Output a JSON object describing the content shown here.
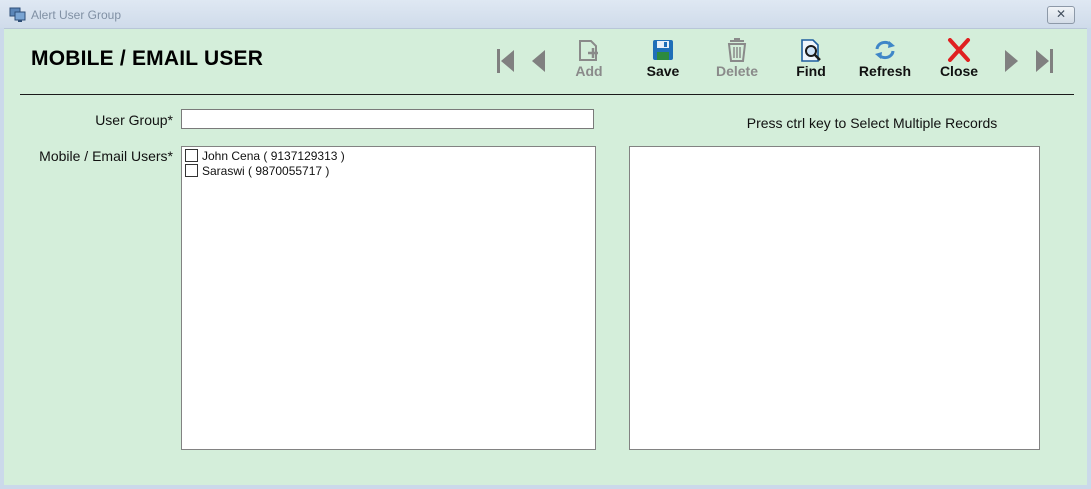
{
  "window": {
    "title": "Alert User Group",
    "close_glyph": "✕"
  },
  "page_title": "MOBILE / EMAIL USER",
  "toolbar": {
    "add": "Add",
    "save": "Save",
    "delete": "Delete",
    "find": "Find",
    "refresh": "Refresh",
    "close": "Close"
  },
  "form": {
    "user_group_label": "User Group*",
    "user_group_value": "",
    "users_label": "Mobile / Email Users*",
    "users": [
      {
        "label": "John Cena ( 9137129313 )",
        "checked": false
      },
      {
        "label": "Saraswi ( 9870055717 )",
        "checked": false
      }
    ],
    "hint": "Press ctrl key to Select Multiple Records"
  },
  "colors": {
    "background": "#d4eeda",
    "close_red": "#e02020",
    "save_blue": "#1f6fb8",
    "disabled_gray": "#8a8a8a"
  },
  "icons": [
    "app-icon",
    "first-record-icon",
    "previous-record-icon",
    "add-icon",
    "save-icon",
    "delete-icon",
    "find-icon",
    "refresh-icon",
    "close-icon",
    "next-record-icon",
    "last-record-icon"
  ]
}
